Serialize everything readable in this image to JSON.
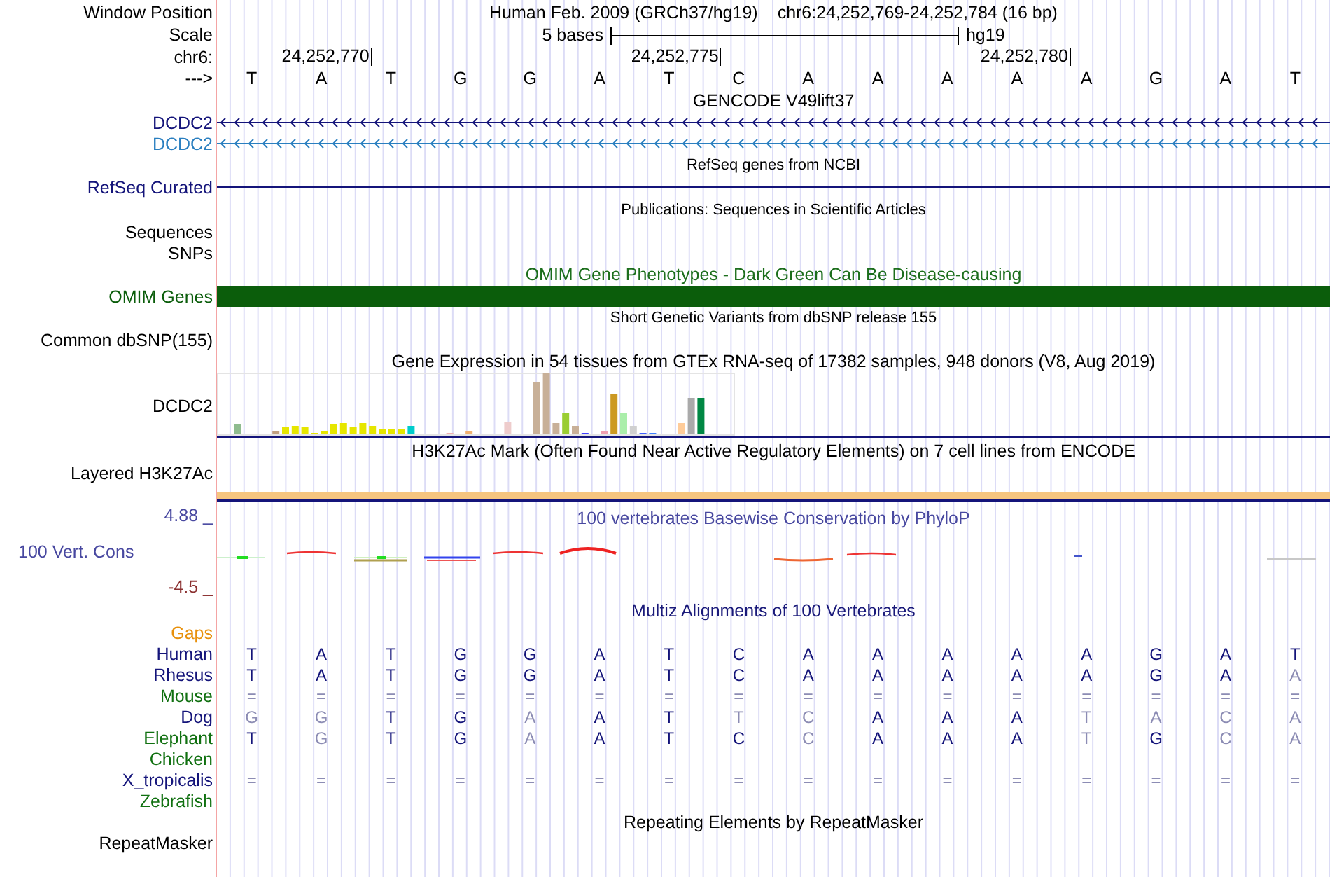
{
  "header": {
    "position_label": "Window Position",
    "assembly": "Human Feb. 2009 (GRCh37/hg19)",
    "position": "chr6:24,252,769-24,252,784 (16 bp)",
    "scale_label": "Scale",
    "scale_text": "5 bases",
    "db": "hg19",
    "ruler_label": "chr6:",
    "strand_label": "--->",
    "bases": [
      {
        "base": "T"
      },
      {
        "base": "A",
        "tick": "24,252,770"
      },
      {
        "base": "T"
      },
      {
        "base": "G"
      },
      {
        "base": "G"
      },
      {
        "base": "A"
      },
      {
        "base": "T",
        "tick": "24,252,775"
      },
      {
        "base": "C"
      },
      {
        "base": "A"
      },
      {
        "base": "A"
      },
      {
        "base": "A"
      },
      {
        "base": "A",
        "tick": "24,252,780"
      },
      {
        "base": "A"
      },
      {
        "base": "G"
      },
      {
        "base": "A"
      },
      {
        "base": "T"
      }
    ]
  },
  "tracks": [
    {
      "kind": "title",
      "text": "GENCODE V49lift37"
    },
    {
      "kind": "gene",
      "label": "DCDC2",
      "color": "#14147a"
    },
    {
      "kind": "gene",
      "label": "DCDC2",
      "color": "#2a7fc0"
    },
    {
      "kind": "title",
      "text": "RefSeq genes from NCBI",
      "small": true
    },
    {
      "kind": "line",
      "label": "RefSeq Curated",
      "color": "#14147a"
    },
    {
      "kind": "title",
      "text": "Publications: Sequences in Scientific Articles",
      "small": true
    },
    {
      "kind": "empty",
      "label": "Sequences"
    },
    {
      "kind": "empty",
      "label": "SNPs"
    },
    {
      "kind": "title",
      "text": "OMIM Gene Phenotypes - Dark Green Can Be Disease-causing",
      "color": "#1c6e1c"
    },
    {
      "kind": "bar",
      "label": "OMIM Genes",
      "color": "#0b5d0b"
    },
    {
      "kind": "title",
      "text": "Short Genetic Variants from dbSNP release 155",
      "small": true
    },
    {
      "kind": "empty",
      "label": "Common dbSNP(155)"
    },
    {
      "kind": "title",
      "text": "Gene Expression in 54 tissues from GTEx RNA-seq of 17382 samples, 948 donors (V8, Aug 2019)"
    },
    {
      "kind": "expression",
      "label": "DCDC2"
    },
    {
      "kind": "title",
      "text": "H3K27Ac Mark (Often Found Near Active Regulatory Elements) on 7 cell lines from ENCODE"
    },
    {
      "kind": "layered",
      "label": "Layered H3K27Ac"
    },
    {
      "kind": "conservation",
      "label": "100 Vert. Cons",
      "color": "#4848a0",
      "max_label": "4.88 _",
      "min_label": "-4.5 _",
      "title": "100 vertebrates Basewise Conservation by PhyloP"
    },
    {
      "kind": "title",
      "text": "Multiz Alignments of 100 Vertebrates",
      "color": "#1a1a7a"
    },
    {
      "kind": "empty",
      "label": "Gaps",
      "color": "#e8900a"
    },
    {
      "kind": "alignment",
      "label": "Human",
      "color": "#14147a",
      "bases": [
        {
          "base": "T",
          "dim": false
        },
        {
          "base": "A",
          "dim": false
        },
        {
          "base": "T",
          "dim": false
        },
        {
          "base": "G",
          "dim": false
        },
        {
          "base": "G",
          "dim": false
        },
        {
          "base": "A",
          "dim": false
        },
        {
          "base": "T",
          "dim": false
        },
        {
          "base": "C",
          "dim": false
        },
        {
          "base": "A",
          "dim": false
        },
        {
          "base": "A",
          "dim": false
        },
        {
          "base": "A",
          "dim": false
        },
        {
          "base": "A",
          "dim": false
        },
        {
          "base": "A",
          "dim": false
        },
        {
          "base": "G",
          "dim": false
        },
        {
          "base": "A",
          "dim": false
        },
        {
          "base": "T",
          "dim": false
        }
      ]
    },
    {
      "kind": "alignment",
      "label": "Rhesus",
      "color": "#14147a",
      "bases": [
        {
          "base": "T",
          "dim": false
        },
        {
          "base": "A",
          "dim": false
        },
        {
          "base": "T",
          "dim": false
        },
        {
          "base": "G",
          "dim": false
        },
        {
          "base": "G",
          "dim": false
        },
        {
          "base": "A",
          "dim": false
        },
        {
          "base": "T",
          "dim": false
        },
        {
          "base": "C",
          "dim": false
        },
        {
          "base": "A",
          "dim": false
        },
        {
          "base": "A",
          "dim": false
        },
        {
          "base": "A",
          "dim": false
        },
        {
          "base": "A",
          "dim": false
        },
        {
          "base": "A",
          "dim": false
        },
        {
          "base": "G",
          "dim": false
        },
        {
          "base": "A",
          "dim": false
        },
        {
          "base": "A",
          "dim": true
        }
      ]
    },
    {
      "kind": "alignment",
      "label": "Mouse",
      "color": "#107010",
      "bases": [
        {
          "base": "=",
          "dim": true
        },
        {
          "base": "=",
          "dim": true
        },
        {
          "base": "=",
          "dim": true
        },
        {
          "base": "=",
          "dim": true
        },
        {
          "base": "=",
          "dim": true
        },
        {
          "base": "=",
          "dim": true
        },
        {
          "base": "=",
          "dim": true
        },
        {
          "base": "=",
          "dim": true
        },
        {
          "base": "=",
          "dim": true
        },
        {
          "base": "=",
          "dim": true
        },
        {
          "base": "=",
          "dim": true
        },
        {
          "base": "=",
          "dim": true
        },
        {
          "base": "=",
          "dim": true
        },
        {
          "base": "=",
          "dim": true
        },
        {
          "base": "=",
          "dim": true
        },
        {
          "base": "=",
          "dim": true
        }
      ]
    },
    {
      "kind": "alignment",
      "label": "Dog",
      "color": "#14147a",
      "bases": [
        {
          "base": "G",
          "dim": true
        },
        {
          "base": "G",
          "dim": true
        },
        {
          "base": "T",
          "dim": false
        },
        {
          "base": "G",
          "dim": false
        },
        {
          "base": "A",
          "dim": true
        },
        {
          "base": "A",
          "dim": false
        },
        {
          "base": "T",
          "dim": false
        },
        {
          "base": "T",
          "dim": true
        },
        {
          "base": "C",
          "dim": true
        },
        {
          "base": "A",
          "dim": false
        },
        {
          "base": "A",
          "dim": false
        },
        {
          "base": "A",
          "dim": false
        },
        {
          "base": "T",
          "dim": true
        },
        {
          "base": "A",
          "dim": true
        },
        {
          "base": "C",
          "dim": true
        },
        {
          "base": "A",
          "dim": true
        }
      ]
    },
    {
      "kind": "alignment",
      "label": "Elephant",
      "color": "#107010",
      "bases": [
        {
          "base": "T",
          "dim": false
        },
        {
          "base": "G",
          "dim": true
        },
        {
          "base": "T",
          "dim": false
        },
        {
          "base": "G",
          "dim": false
        },
        {
          "base": "A",
          "dim": true
        },
        {
          "base": "A",
          "dim": false
        },
        {
          "base": "T",
          "dim": false
        },
        {
          "base": "C",
          "dim": false
        },
        {
          "base": "C",
          "dim": true
        },
        {
          "base": "A",
          "dim": false
        },
        {
          "base": "A",
          "dim": false
        },
        {
          "base": "A",
          "dim": false
        },
        {
          "base": "T",
          "dim": true
        },
        {
          "base": "G",
          "dim": false
        },
        {
          "base": "C",
          "dim": true
        },
        {
          "base": "A",
          "dim": true
        }
      ]
    },
    {
      "kind": "empty",
      "label": "Chicken",
      "color": "#107010"
    },
    {
      "kind": "alignment",
      "label": "X_tropicalis",
      "color": "#14147a",
      "bases": [
        {
          "base": "=",
          "dim": true
        },
        {
          "base": "=",
          "dim": true
        },
        {
          "base": "=",
          "dim": true
        },
        {
          "base": "=",
          "dim": true
        },
        {
          "base": "=",
          "dim": true
        },
        {
          "base": "=",
          "dim": true
        },
        {
          "base": "=",
          "dim": true
        },
        {
          "base": "=",
          "dim": true
        },
        {
          "base": "=",
          "dim": true
        },
        {
          "base": "=",
          "dim": true
        },
        {
          "base": "=",
          "dim": true
        },
        {
          "base": "=",
          "dim": true
        },
        {
          "base": "=",
          "dim": true
        },
        {
          "base": "=",
          "dim": true
        },
        {
          "base": "=",
          "dim": true
        },
        {
          "base": "=",
          "dim": true
        }
      ]
    },
    {
      "kind": "empty",
      "label": "Zebrafish",
      "color": "#107010"
    },
    {
      "kind": "title",
      "text": "Repeating Elements by RepeatMasker"
    },
    {
      "kind": "empty",
      "label": "RepeatMasker"
    }
  ]
}
